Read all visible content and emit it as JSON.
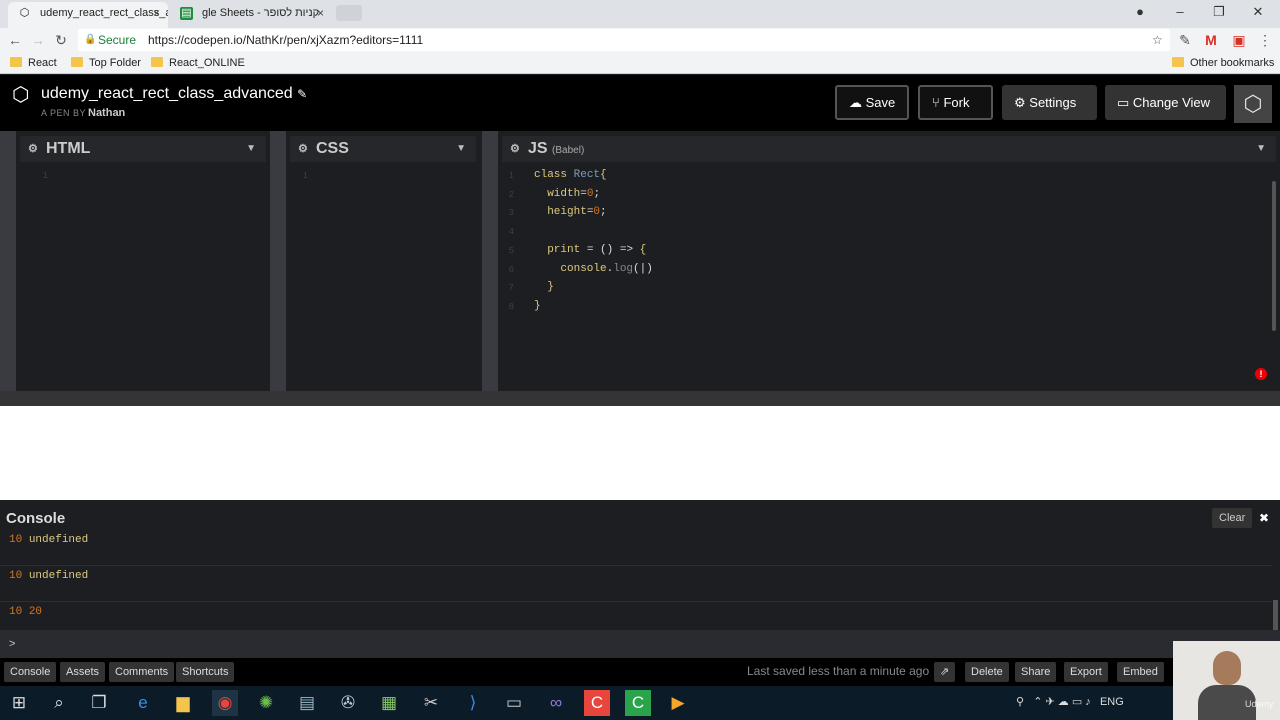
{
  "browser": {
    "tabs": [
      {
        "label": "udemy_react_rect_class_a",
        "icon": "codepen-icon"
      },
      {
        "label": "gle Sheets - קניות לסופר",
        "icon": "sheets-icon"
      }
    ],
    "secure_label": "Secure",
    "url": "https://codepen.io/NathKr/pen/xjXazm?editors=1111",
    "bookmarks": [
      "React",
      "Top Folder",
      "React_ONLINE"
    ],
    "other_bookmarks": "Other bookmarks"
  },
  "header": {
    "title": "udemy_react_rect_class_advanced",
    "by_label": "A PEN BY",
    "author": "Nathan",
    "save": "Save",
    "fork": "Fork",
    "settings": "Settings",
    "change_view": "Change View"
  },
  "editors": {
    "html": {
      "label": "HTML"
    },
    "css": {
      "label": "CSS"
    },
    "js": {
      "label": "JS",
      "sublabel": "(Babel)"
    }
  },
  "console": {
    "title": "Console",
    "clear": "Clear",
    "lines": [
      {
        "num": "10",
        "val": "undefined"
      },
      {
        "num": "10",
        "val": "undefined"
      },
      {
        "num": "10",
        "val": "20"
      }
    ],
    "prompt": ">"
  },
  "footer": {
    "console": "Console",
    "assets": "Assets",
    "comments": "Comments",
    "shortcuts": "Shortcuts",
    "saved": "Last saved less than a minute ago",
    "delete": "Delete",
    "share": "Share",
    "export": "Export",
    "embed": "Embed"
  },
  "taskbar": {
    "tray_lang": "ENG",
    "watermark": "Udemy"
  },
  "colors": {
    "keyword": "#ddca7e",
    "classname": "#809bbd",
    "number": "#d0782a",
    "error": "#ee0000"
  }
}
